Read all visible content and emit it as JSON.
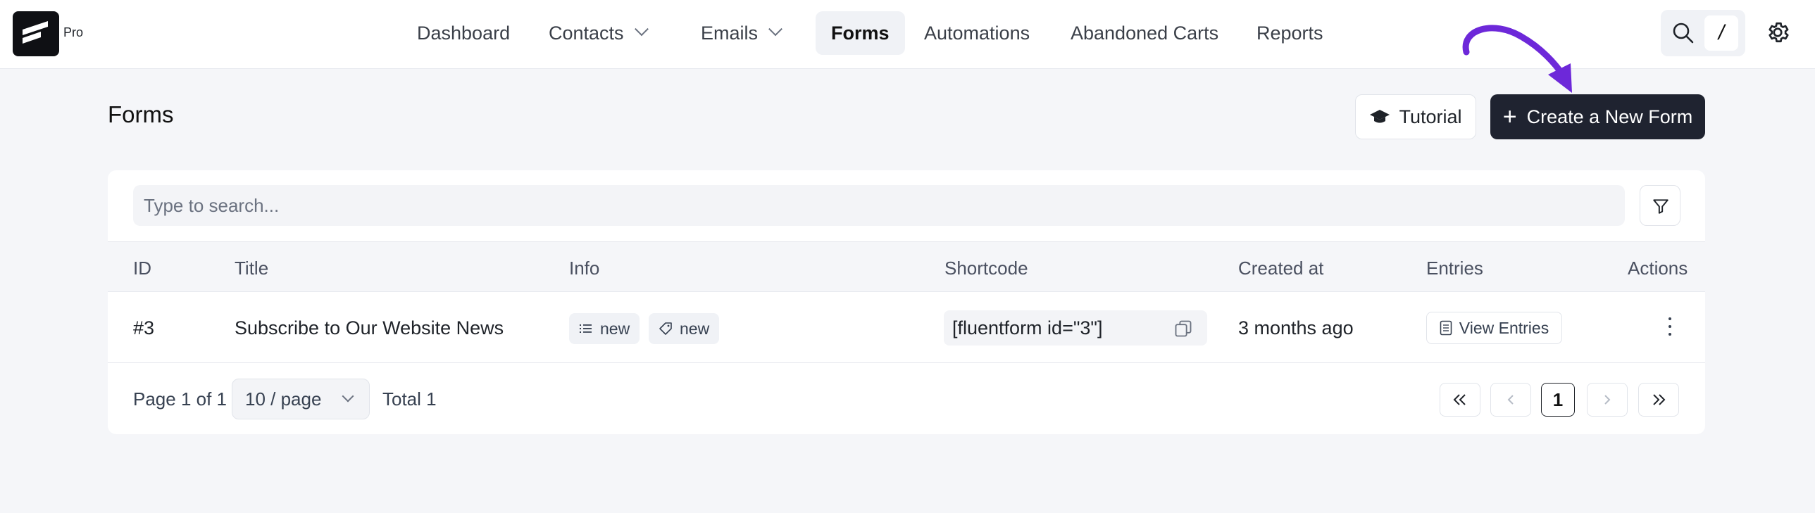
{
  "app": {
    "badge": "Pro"
  },
  "nav": {
    "items": [
      {
        "label": "Dashboard"
      },
      {
        "label": "Contacts"
      },
      {
        "label": "Emails"
      },
      {
        "label": "Forms"
      },
      {
        "label": "Automations"
      },
      {
        "label": "Abandoned Carts"
      },
      {
        "label": "Reports"
      }
    ],
    "shortcut_key": "/"
  },
  "header": {
    "title": "Forms",
    "tutorial_label": "Tutorial",
    "create_label": "Create a New Form"
  },
  "search": {
    "placeholder": "Type to search..."
  },
  "table": {
    "columns": [
      "ID",
      "Title",
      "Info",
      "Shortcode",
      "Created at",
      "Entries",
      "Actions"
    ],
    "rows": [
      {
        "id": "#3",
        "title": "Subscribe to Our Website News",
        "info": [
          "new",
          "new"
        ],
        "shortcode": "[fluentform id=\"3\"]",
        "created_at": "3 months ago",
        "entries_label": "View Entries"
      }
    ]
  },
  "pagination": {
    "page_info": "Page 1 of 1",
    "per_page": "10 / page",
    "total": "Total 1",
    "current_page": "1"
  },
  "colors": {
    "primary_button": "#1f2330",
    "annotation_arrow": "#6d28d9",
    "background": "#f5f6f9"
  }
}
